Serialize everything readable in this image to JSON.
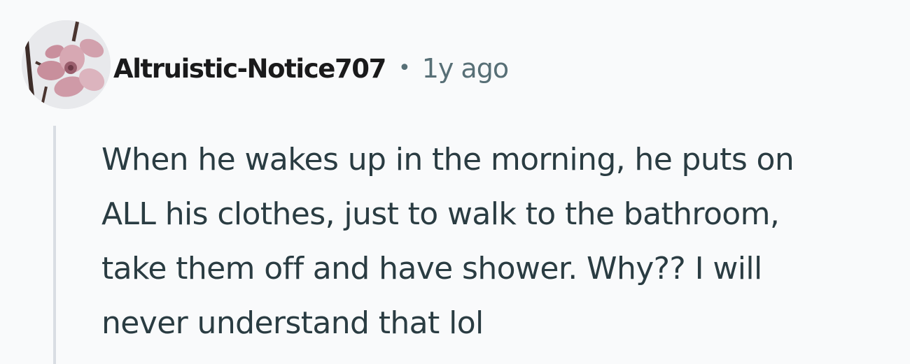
{
  "comment": {
    "author": "Altruistic-Notice707",
    "separator": "•",
    "timestamp": "1y ago",
    "avatar_icon": "cherry-blossom-avatar-icon",
    "body_lines": [
      "When he wakes up in the morning, he puts on",
      "ALL his clothes, just to walk to the bathroom,",
      "take them off and have shower. Why?? I will",
      "never understand that lol"
    ]
  },
  "colors": {
    "background": "#f9fafb",
    "username": "#1a1a1b",
    "meta": "#576f76",
    "body": "#2a3c42",
    "thread_line": "#d9dde3"
  }
}
